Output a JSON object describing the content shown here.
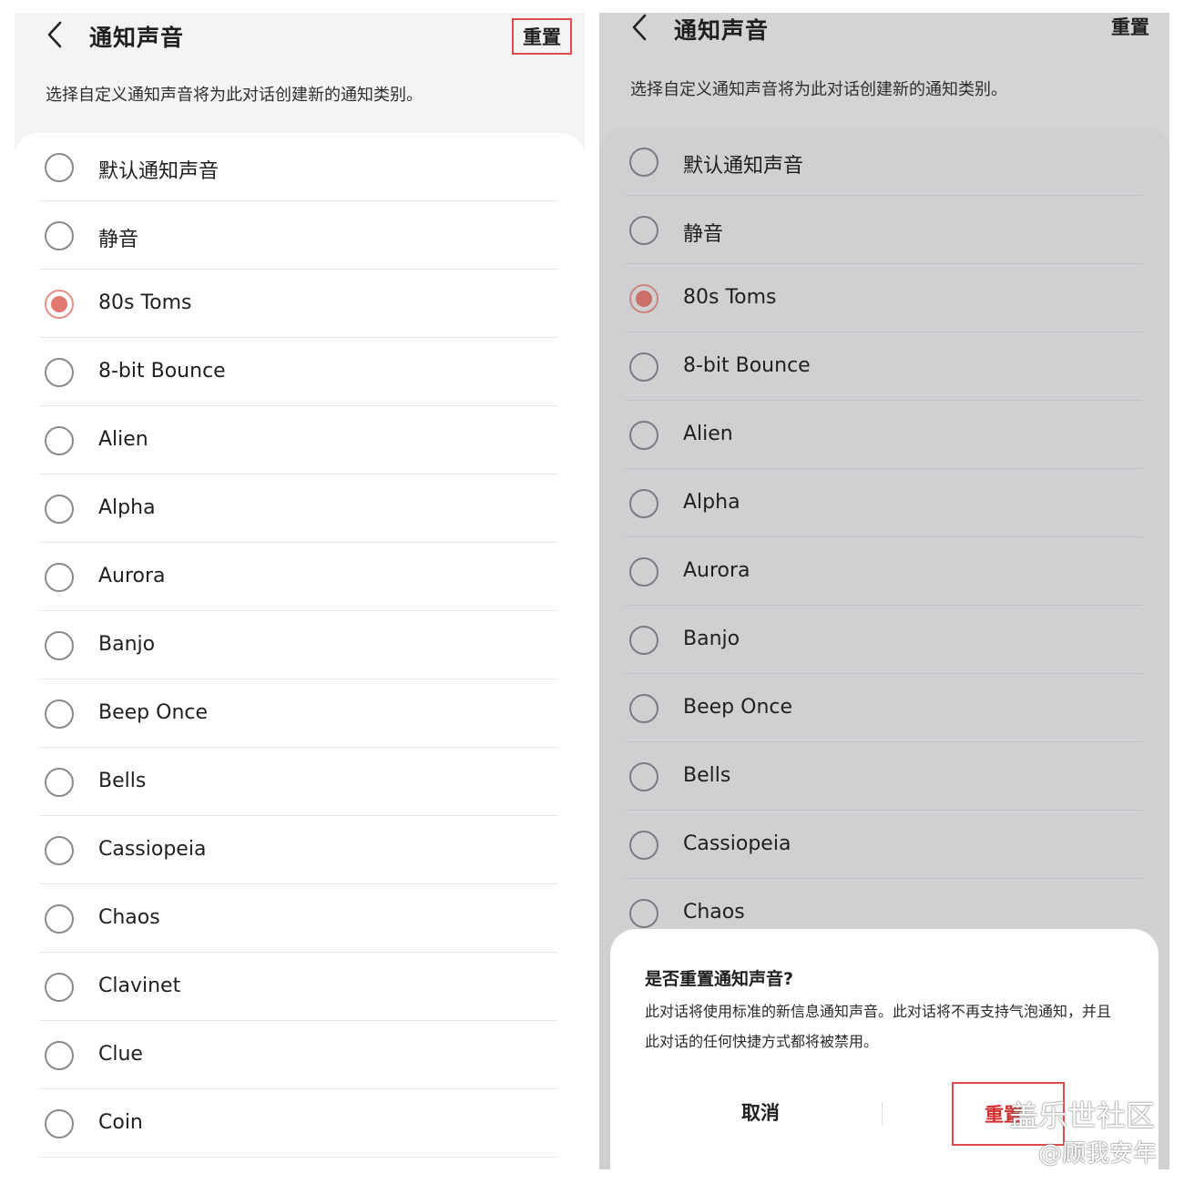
{
  "header": {
    "title": "通知声音",
    "reset_label": "重置"
  },
  "description": "选择自定义通知声音将为此对话创建新的通知类别。",
  "left_list": [
    {
      "label": "默认通知声音",
      "selected": false
    },
    {
      "label": "静音",
      "selected": false
    },
    {
      "label": "80s Toms",
      "selected": true
    },
    {
      "label": "8-bit Bounce",
      "selected": false
    },
    {
      "label": "Alien",
      "selected": false
    },
    {
      "label": "Alpha",
      "selected": false
    },
    {
      "label": "Aurora",
      "selected": false
    },
    {
      "label": "Banjo",
      "selected": false
    },
    {
      "label": "Beep Once",
      "selected": false
    },
    {
      "label": "Bells",
      "selected": false
    },
    {
      "label": "Cassiopeia",
      "selected": false
    },
    {
      "label": "Chaos",
      "selected": false
    },
    {
      "label": "Clavinet",
      "selected": false
    },
    {
      "label": "Clue",
      "selected": false
    },
    {
      "label": "Coin",
      "selected": false
    }
  ],
  "right_list": [
    {
      "label": "默认通知声音",
      "selected": false
    },
    {
      "label": "静音",
      "selected": false
    },
    {
      "label": "80s Toms",
      "selected": true
    },
    {
      "label": "8-bit Bounce",
      "selected": false
    },
    {
      "label": "Alien",
      "selected": false
    },
    {
      "label": "Alpha",
      "selected": false
    },
    {
      "label": "Aurora",
      "selected": false
    },
    {
      "label": "Banjo",
      "selected": false
    },
    {
      "label": "Beep Once",
      "selected": false
    },
    {
      "label": "Bells",
      "selected": false
    },
    {
      "label": "Cassiopeia",
      "selected": false
    },
    {
      "label": "Chaos",
      "selected": false
    }
  ],
  "dialog": {
    "title": "是否重置通知声音?",
    "body": "此对话将使用标准的新信息通知声音。此对话将不再支持气泡通知，并且此对话的任何快捷方式都将被禁用。",
    "cancel_label": "取消",
    "confirm_label": "重置"
  },
  "watermark": {
    "line1": "盖乐世社区",
    "line2": "@顾我安年"
  },
  "colors": {
    "accent": "#e2786f",
    "highlight_border": "#e04a4a",
    "confirm_text": "#d32f2f"
  }
}
